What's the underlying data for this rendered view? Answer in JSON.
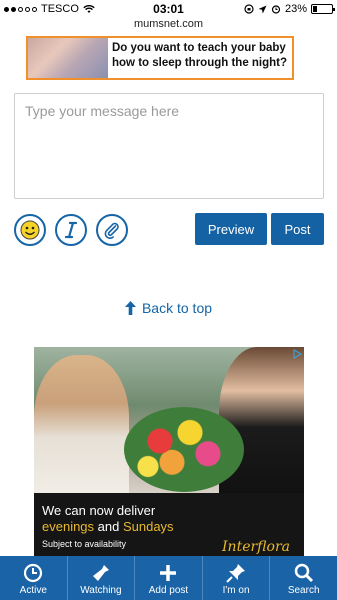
{
  "status_bar": {
    "carrier": "TESCO",
    "time": "03:01",
    "battery": "23%",
    "battery_level": 0.23
  },
  "browser": {
    "url": "mumsnet.com"
  },
  "banner_ad": {
    "text": "Do you want to teach your baby how to sleep through the night?"
  },
  "composer": {
    "placeholder": "Type your message here",
    "preview_label": "Preview",
    "post_label": "Post",
    "tools": [
      "smiley-icon",
      "italic-icon",
      "paperclip-icon"
    ]
  },
  "back_to_top": {
    "label": "Back to top"
  },
  "ad": {
    "line1": "We can now deliver",
    "line2_a": "evenings",
    "line2_b": " and ",
    "line2_c": "Sundays",
    "line3": "Subject to availability",
    "logo": "Interflora"
  },
  "tabbar": {
    "items": [
      {
        "label": "Active",
        "icon": "clock-icon"
      },
      {
        "label": "Watching",
        "icon": "torch-icon"
      },
      {
        "label": "Add post",
        "icon": "plus-icon"
      },
      {
        "label": "I'm on",
        "icon": "pin-icon"
      },
      {
        "label": "Search",
        "icon": "search-icon"
      }
    ]
  },
  "colors": {
    "brand_blue": "#1461a4",
    "banner_border": "#f0902c",
    "ad_highlight": "#e8b930"
  }
}
